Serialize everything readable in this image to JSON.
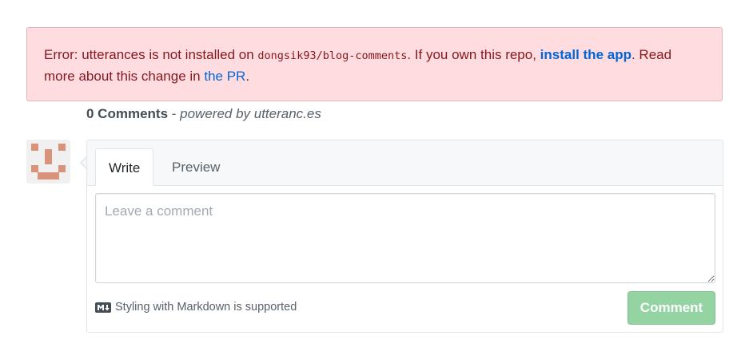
{
  "error_banner": {
    "prefix": "Error: utterances is not installed on ",
    "repo": "dongsik93/blog-comments",
    "middle": ". If you own this repo, ",
    "install_link": "install the app",
    "after_link": ". Read more about this change in ",
    "pr_link": "the PR",
    "suffix": "."
  },
  "header": {
    "count_label": "0 Comments",
    "separator": " - ",
    "powered_by": "powered by utteranc.es"
  },
  "editor": {
    "tabs": [
      {
        "label": "Write",
        "selected": true
      },
      {
        "label": "Preview",
        "selected": false
      }
    ],
    "placeholder": "Leave a comment",
    "markdown_note": "Styling with Markdown is supported",
    "submit_label": "Comment"
  },
  "colors": {
    "error_bg": "#ffdce0",
    "error_text": "#86181d",
    "link": "#0366d6",
    "submit_bg": "#94d3a2",
    "avatar": "#d8937a"
  },
  "icons": {
    "avatar": "identicon-avatar",
    "markdown": "markdown-icon"
  }
}
